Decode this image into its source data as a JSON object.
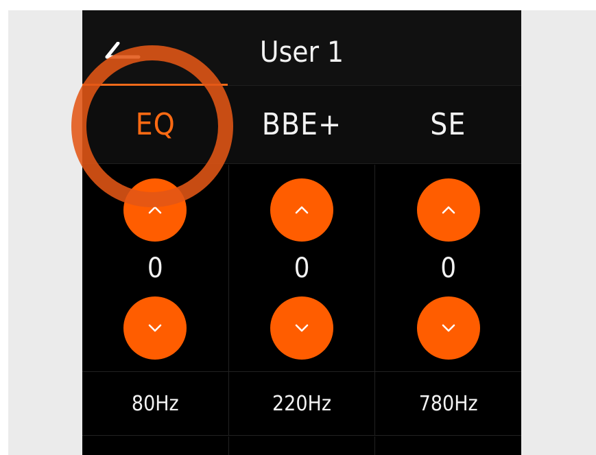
{
  "header": {
    "title": "User 1",
    "back_icon": "back-arrow-icon"
  },
  "tabs": [
    {
      "label": "EQ",
      "active": true
    },
    {
      "label": "BBE+",
      "active": false
    },
    {
      "label": "SE",
      "active": false
    }
  ],
  "bands": [
    {
      "value": "0",
      "frequency": "80Hz"
    },
    {
      "value": "0",
      "frequency": "220Hz"
    },
    {
      "value": "0",
      "frequency": "780Hz"
    }
  ],
  "icons": {
    "increase": "chevron-up-icon",
    "decrease": "chevron-down-icon"
  },
  "colors": {
    "accent": "#ff5d00",
    "active_tab": "#ff6a13",
    "highlight_ring": "#e25616",
    "background": "#000000",
    "text": "#f2f2f2"
  }
}
